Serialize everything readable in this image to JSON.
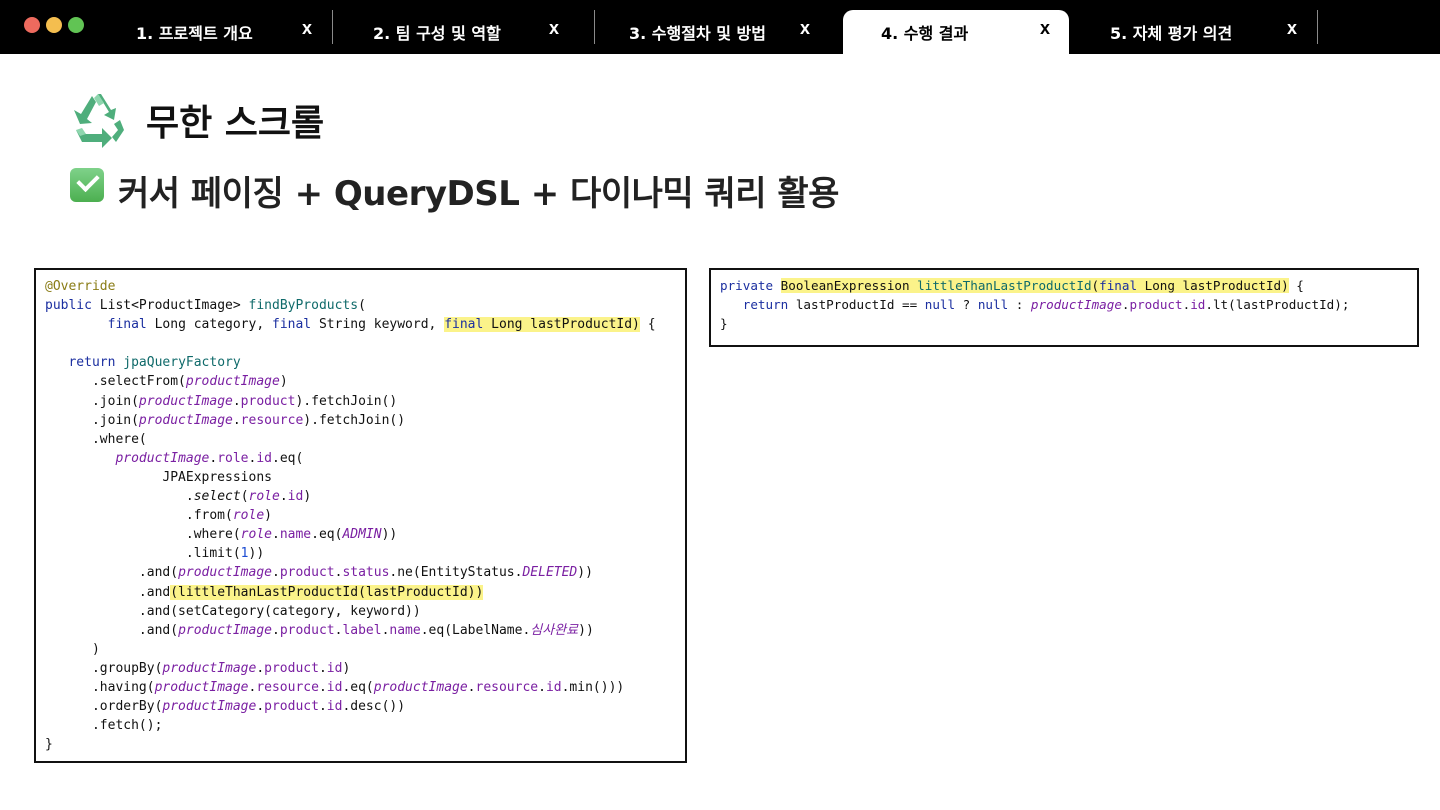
{
  "tabs": [
    {
      "label": "1. 프로젝트 개요",
      "close": "x",
      "active": false
    },
    {
      "label": "2. 팀 구성 및 역할",
      "close": "x",
      "active": false
    },
    {
      "label": "3. 수행절차 및 방법",
      "close": "x",
      "active": false
    },
    {
      "label": "4. 수행 결과",
      "close": "x",
      "active": true
    },
    {
      "label": "5. 자체 평가 의견",
      "close": "x",
      "active": false
    }
  ],
  "heading": {
    "icon": "recycle-icon",
    "title": "무한 스크롤",
    "subtitle_icon": "check-box-icon",
    "subtitle": "커서 페이징 + QueryDSL + 다이나믹 쿼리 활용"
  },
  "code_left": [
    "@Override",
    "public List<ProductImage> findByProducts(",
    "        final Long category, final String keyword, final Long lastProductId) {",
    "",
    "   return jpaQueryFactory",
    "      .selectFrom(productImage)",
    "      .join(productImage.product).fetchJoin()",
    "      .join(productImage.resource).fetchJoin()",
    "      .where(",
    "         productImage.role.id.eq(",
    "               JPAExpressions",
    "                  .select(role.id)",
    "                  .from(role)",
    "                  .where(role.name.eq(ADMIN))",
    "                  .limit(1))",
    "            .and(productImage.product.status.ne(EntityStatus.DELETED))",
    "            .and(littleThanLastProductId(lastProductId))",
    "            .and(setCategory(category, keyword))",
    "            .and(productImage.product.label.name.eq(LabelName.심사완료))",
    "      )",
    "      .groupBy(productImage.product.id)",
    "      .having(productImage.resource.id.eq(productImage.resource.id.min()))",
    "      .orderBy(productImage.product.id.desc())",
    "      .fetch();",
    "}"
  ],
  "code_right": [
    "private BooleanExpression littleThanLastProductId(final Long lastProductId) {",
    "   return lastProductId == null ? null : productImage.product.id.lt(lastProductId);",
    "}"
  ],
  "colors": {
    "keyword": "#1b2fa0",
    "annotation": "#8a7c16",
    "method": "#0f6a6a",
    "field": "#7a1fa2",
    "number": "#1b4bd2",
    "highlight": "#fbf38a"
  }
}
